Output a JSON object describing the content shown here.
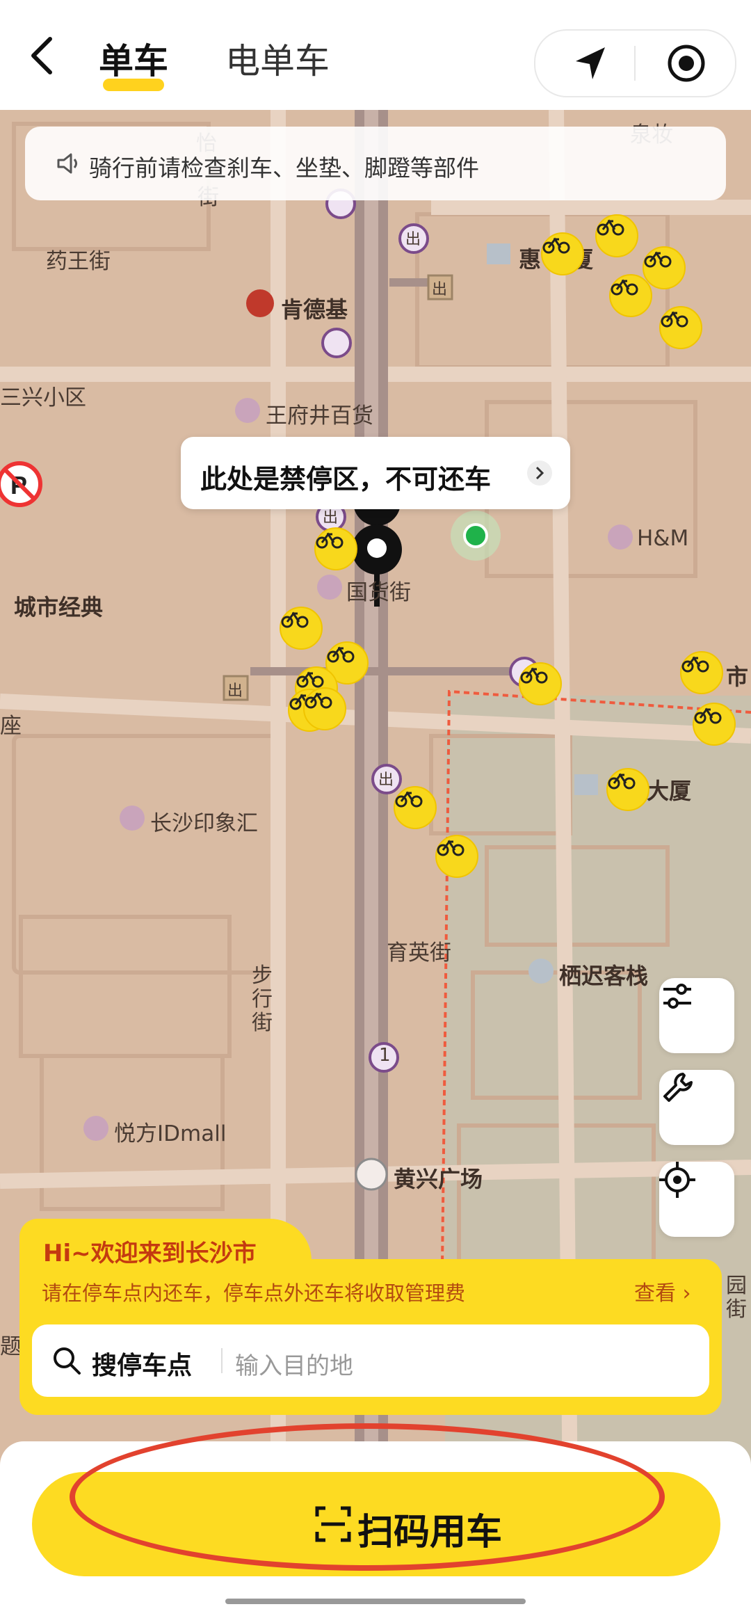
{
  "header": {
    "tabs": [
      {
        "label": "单车",
        "active": true
      },
      {
        "label": "电单车",
        "active": false
      }
    ],
    "icons": [
      "back-arrow-icon",
      "navigation-arrow-icon",
      "target-icon"
    ]
  },
  "notice": {
    "text": "骑行前请检查刹车、坐垫、脚蹬等部件",
    "icon": "speaker-icon"
  },
  "map": {
    "labels": {
      "yaowang": "药王街",
      "kfc": "肯德基",
      "sanxing": "三兴小区",
      "wangfujing": "王府井百货",
      "hm": "H&M",
      "guohuo": "国货街",
      "chengshi": "城市经典",
      "zuo": "座",
      "changsha_yxh": "长沙印象汇",
      "huiyuan": "惠  大厦",
      "quanbang": "泉妆",
      "dasha2": "大厦",
      "yuying": "育英街",
      "qichi": "栖迟客栈",
      "buxing": "步行街",
      "yuefang": "悦方IDmall",
      "huangxing": "黄兴广场",
      "shi": "市",
      "yuanjie": "园街",
      "yi": "怡",
      "jie": "街",
      "gao": "题",
      "metro1": "1"
    },
    "exit_badge": "出",
    "no_parking_tip": "此处是禁停区，不可还车",
    "side_buttons": [
      "filter-icon",
      "wrench-icon",
      "locate-icon"
    ]
  },
  "card": {
    "welcome": "Hi~欢迎来到长沙市",
    "rule": "请在停车点内还车，停车点外还车将收取管理费",
    "view_link": "查看",
    "search_label": "搜停车点",
    "search_placeholder": "输入目的地"
  },
  "bottom": {
    "scan_button": "扫码用车"
  },
  "colors": {
    "brand_yellow": "#fddb22",
    "map_bg": "#d9bba3",
    "annotation_red": "#e2422e"
  }
}
